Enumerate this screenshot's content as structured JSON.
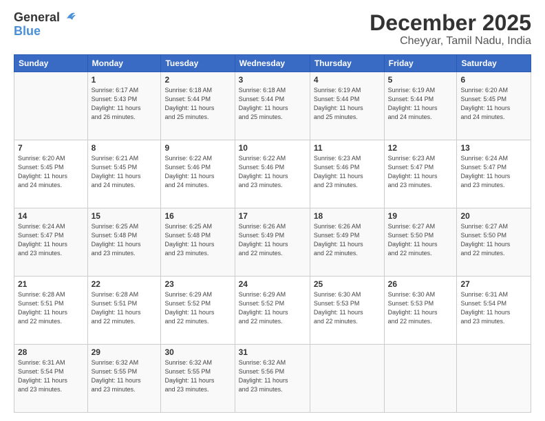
{
  "logo": {
    "line1": "General",
    "line2": "Blue"
  },
  "title": "December 2025",
  "subtitle": "Cheyyar, Tamil Nadu, India",
  "header_days": [
    "Sunday",
    "Monday",
    "Tuesday",
    "Wednesday",
    "Thursday",
    "Friday",
    "Saturday"
  ],
  "weeks": [
    [
      {
        "day": "",
        "info": ""
      },
      {
        "day": "1",
        "info": "Sunrise: 6:17 AM\nSunset: 5:43 PM\nDaylight: 11 hours\nand 26 minutes."
      },
      {
        "day": "2",
        "info": "Sunrise: 6:18 AM\nSunset: 5:44 PM\nDaylight: 11 hours\nand 25 minutes."
      },
      {
        "day": "3",
        "info": "Sunrise: 6:18 AM\nSunset: 5:44 PM\nDaylight: 11 hours\nand 25 minutes."
      },
      {
        "day": "4",
        "info": "Sunrise: 6:19 AM\nSunset: 5:44 PM\nDaylight: 11 hours\nand 25 minutes."
      },
      {
        "day": "5",
        "info": "Sunrise: 6:19 AM\nSunset: 5:44 PM\nDaylight: 11 hours\nand 24 minutes."
      },
      {
        "day": "6",
        "info": "Sunrise: 6:20 AM\nSunset: 5:45 PM\nDaylight: 11 hours\nand 24 minutes."
      }
    ],
    [
      {
        "day": "7",
        "info": "Sunrise: 6:20 AM\nSunset: 5:45 PM\nDaylight: 11 hours\nand 24 minutes."
      },
      {
        "day": "8",
        "info": "Sunrise: 6:21 AM\nSunset: 5:45 PM\nDaylight: 11 hours\nand 24 minutes."
      },
      {
        "day": "9",
        "info": "Sunrise: 6:22 AM\nSunset: 5:46 PM\nDaylight: 11 hours\nand 24 minutes."
      },
      {
        "day": "10",
        "info": "Sunrise: 6:22 AM\nSunset: 5:46 PM\nDaylight: 11 hours\nand 23 minutes."
      },
      {
        "day": "11",
        "info": "Sunrise: 6:23 AM\nSunset: 5:46 PM\nDaylight: 11 hours\nand 23 minutes."
      },
      {
        "day": "12",
        "info": "Sunrise: 6:23 AM\nSunset: 5:47 PM\nDaylight: 11 hours\nand 23 minutes."
      },
      {
        "day": "13",
        "info": "Sunrise: 6:24 AM\nSunset: 5:47 PM\nDaylight: 11 hours\nand 23 minutes."
      }
    ],
    [
      {
        "day": "14",
        "info": "Sunrise: 6:24 AM\nSunset: 5:47 PM\nDaylight: 11 hours\nand 23 minutes."
      },
      {
        "day": "15",
        "info": "Sunrise: 6:25 AM\nSunset: 5:48 PM\nDaylight: 11 hours\nand 23 minutes."
      },
      {
        "day": "16",
        "info": "Sunrise: 6:25 AM\nSunset: 5:48 PM\nDaylight: 11 hours\nand 23 minutes."
      },
      {
        "day": "17",
        "info": "Sunrise: 6:26 AM\nSunset: 5:49 PM\nDaylight: 11 hours\nand 22 minutes."
      },
      {
        "day": "18",
        "info": "Sunrise: 6:26 AM\nSunset: 5:49 PM\nDaylight: 11 hours\nand 22 minutes."
      },
      {
        "day": "19",
        "info": "Sunrise: 6:27 AM\nSunset: 5:50 PM\nDaylight: 11 hours\nand 22 minutes."
      },
      {
        "day": "20",
        "info": "Sunrise: 6:27 AM\nSunset: 5:50 PM\nDaylight: 11 hours\nand 22 minutes."
      }
    ],
    [
      {
        "day": "21",
        "info": "Sunrise: 6:28 AM\nSunset: 5:51 PM\nDaylight: 11 hours\nand 22 minutes."
      },
      {
        "day": "22",
        "info": "Sunrise: 6:28 AM\nSunset: 5:51 PM\nDaylight: 11 hours\nand 22 minutes."
      },
      {
        "day": "23",
        "info": "Sunrise: 6:29 AM\nSunset: 5:52 PM\nDaylight: 11 hours\nand 22 minutes."
      },
      {
        "day": "24",
        "info": "Sunrise: 6:29 AM\nSunset: 5:52 PM\nDaylight: 11 hours\nand 22 minutes."
      },
      {
        "day": "25",
        "info": "Sunrise: 6:30 AM\nSunset: 5:53 PM\nDaylight: 11 hours\nand 22 minutes."
      },
      {
        "day": "26",
        "info": "Sunrise: 6:30 AM\nSunset: 5:53 PM\nDaylight: 11 hours\nand 22 minutes."
      },
      {
        "day": "27",
        "info": "Sunrise: 6:31 AM\nSunset: 5:54 PM\nDaylight: 11 hours\nand 23 minutes."
      }
    ],
    [
      {
        "day": "28",
        "info": "Sunrise: 6:31 AM\nSunset: 5:54 PM\nDaylight: 11 hours\nand 23 minutes."
      },
      {
        "day": "29",
        "info": "Sunrise: 6:32 AM\nSunset: 5:55 PM\nDaylight: 11 hours\nand 23 minutes."
      },
      {
        "day": "30",
        "info": "Sunrise: 6:32 AM\nSunset: 5:55 PM\nDaylight: 11 hours\nand 23 minutes."
      },
      {
        "day": "31",
        "info": "Sunrise: 6:32 AM\nSunset: 5:56 PM\nDaylight: 11 hours\nand 23 minutes."
      },
      {
        "day": "",
        "info": ""
      },
      {
        "day": "",
        "info": ""
      },
      {
        "day": "",
        "info": ""
      }
    ]
  ]
}
